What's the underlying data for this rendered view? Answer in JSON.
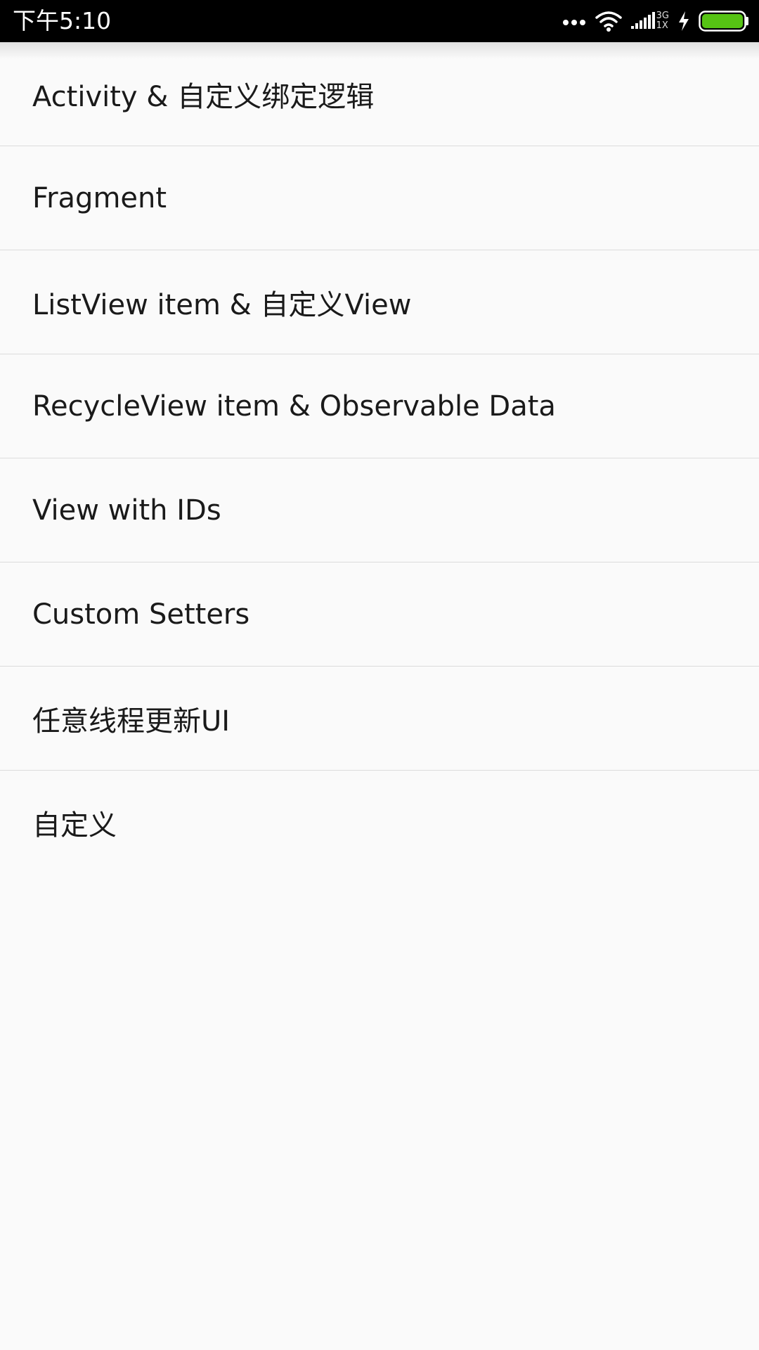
{
  "status_bar": {
    "time": "下午5:10",
    "network_top": "3G",
    "network_bottom": "1X",
    "icons": [
      "more-dots-icon",
      "wifi-icon",
      "signal-icon",
      "charging-icon",
      "battery-icon"
    ],
    "battery_level": 1.0,
    "battery_color": "#56c314"
  },
  "list": {
    "items": [
      {
        "label": "Activity & 自定义绑定逻辑"
      },
      {
        "label": "Fragment"
      },
      {
        "label": "ListView item & 自定义View"
      },
      {
        "label": "RecycleView item & Observable Data"
      },
      {
        "label": "View with IDs"
      },
      {
        "label": "Custom Setters"
      },
      {
        "label": "任意线程更新UI"
      },
      {
        "label": "自定义"
      }
    ]
  },
  "colors": {
    "background": "#fafafa",
    "status_bar": "#000000",
    "divider": "#dcdcdc",
    "text": "#1a1a1a"
  }
}
